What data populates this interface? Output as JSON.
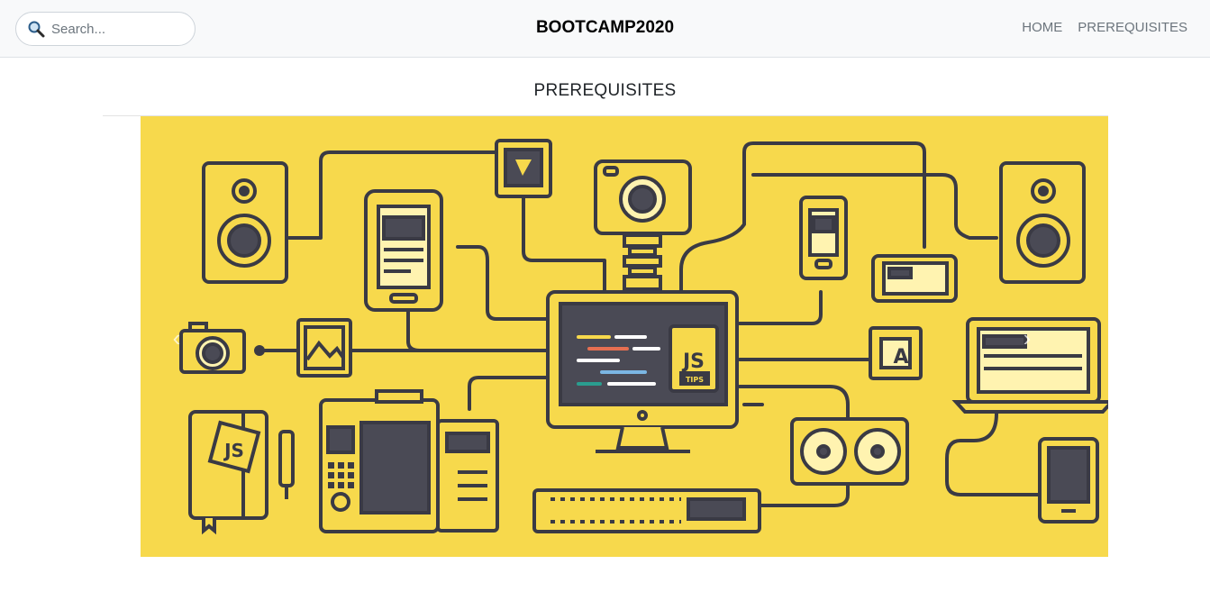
{
  "search": {
    "placeholder": "Search..."
  },
  "brand": "BOOTCAMP2020",
  "nav": {
    "home": "HOME",
    "prerequisites": "PREREQUISITES"
  },
  "page_title": "PREREQUISITES",
  "carousel": {
    "prev_symbol": "‹",
    "next_symbol": "›",
    "illustration": {
      "background": "#f7d94c",
      "stroke": "#3a3a44",
      "screen": "#4a4a55",
      "badge_text": "JS",
      "badge_subtext": "TIPS",
      "notebook_text": "JS",
      "a_box_text": "A"
    }
  },
  "colors": {
    "navbar_bg": "#f8f9fa",
    "accent_yellow": "#f7d94c",
    "dark": "#3a3a44"
  }
}
